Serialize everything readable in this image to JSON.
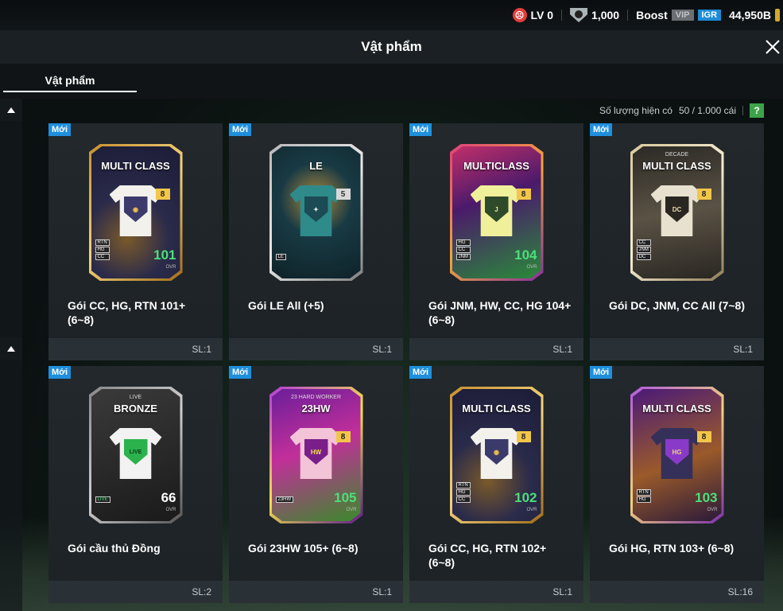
{
  "topbar": {
    "level": "LV 0",
    "points": "1,000",
    "boost": "Boost",
    "vip": "VIP",
    "igr": "IGR",
    "balance": "44,950B"
  },
  "header": {
    "title": "Vật phẩm"
  },
  "tabs": [
    {
      "label": "Vật phẩm",
      "active": true
    }
  ],
  "quantity": {
    "label": "Số lượng hiện có",
    "value": "50 / 1.000 cái",
    "help": "?"
  },
  "colors": {
    "new_badge": "#1f8fdd",
    "accent_green": "#3da34a",
    "igr_blue": "#1e8bd6"
  },
  "items": [
    {
      "new": "Mới",
      "card_title": "MULTI CLASS",
      "card_subtitle": "",
      "grade": "8",
      "tags": [
        "RTN",
        "HG",
        "CC"
      ],
      "ovr": "101",
      "ovr_label": "OVR",
      "name": "Gói CC, HG, RTN 101+ (6~8)",
      "count": "SL:1"
    },
    {
      "new": "Mới",
      "card_title": "LE",
      "card_subtitle": "",
      "grade": "5",
      "tags": [
        "LE"
      ],
      "ovr": "",
      "ovr_label": "",
      "name": "Gói LE All (+5)",
      "count": "SL:1"
    },
    {
      "new": "Mới",
      "card_title": "MULTICLASS",
      "card_subtitle": "",
      "grade": "8",
      "tags": [
        "HG",
        "CC",
        "JNM"
      ],
      "ovr": "104",
      "ovr_label": "OVR",
      "name": "Gói JNM, HW, CC, HG 104+ (6~8)",
      "count": "SL:1"
    },
    {
      "new": "Mới",
      "card_title": "MULTI CLASS",
      "card_subtitle": "DECADE",
      "grade": "8",
      "tags": [
        "CC",
        "JNM",
        "DC"
      ],
      "ovr": "",
      "ovr_label": "",
      "name": "Gói DC, JNM, CC All (7~8)",
      "count": "SL:1"
    },
    {
      "new": "Mới",
      "card_title": "BRONZE",
      "card_subtitle": "LIVE",
      "grade": "",
      "tags": [
        "LIVE"
      ],
      "ovr": "66",
      "ovr_label": "OVR",
      "name": "Gói cầu thủ Đồng",
      "count": "SL:2"
    },
    {
      "new": "Mới",
      "card_title": "23HW",
      "card_subtitle": "23 HARD WORKER",
      "grade": "8",
      "tags": [
        "23HW"
      ],
      "ovr": "105",
      "ovr_label": "OVR",
      "name": "Gói 23HW 105+ (6~8)",
      "count": "SL:1"
    },
    {
      "new": "Mới",
      "card_title": "MULTI CLASS",
      "card_subtitle": "",
      "grade": "8",
      "tags": [
        "RTN",
        "HG",
        "CC"
      ],
      "ovr": "102",
      "ovr_label": "OVR",
      "name": "Gói CC, HG, RTN 102+ (6~8)",
      "count": "SL:1"
    },
    {
      "new": "Mới",
      "card_title": "MULTI CLASS",
      "card_subtitle": "",
      "grade": "8",
      "tags": [
        "RTN",
        "HG"
      ],
      "ovr": "103",
      "ovr_label": "OVR",
      "name": "Gói HG, RTN 103+ (6~8)",
      "count": "SL:16"
    }
  ]
}
